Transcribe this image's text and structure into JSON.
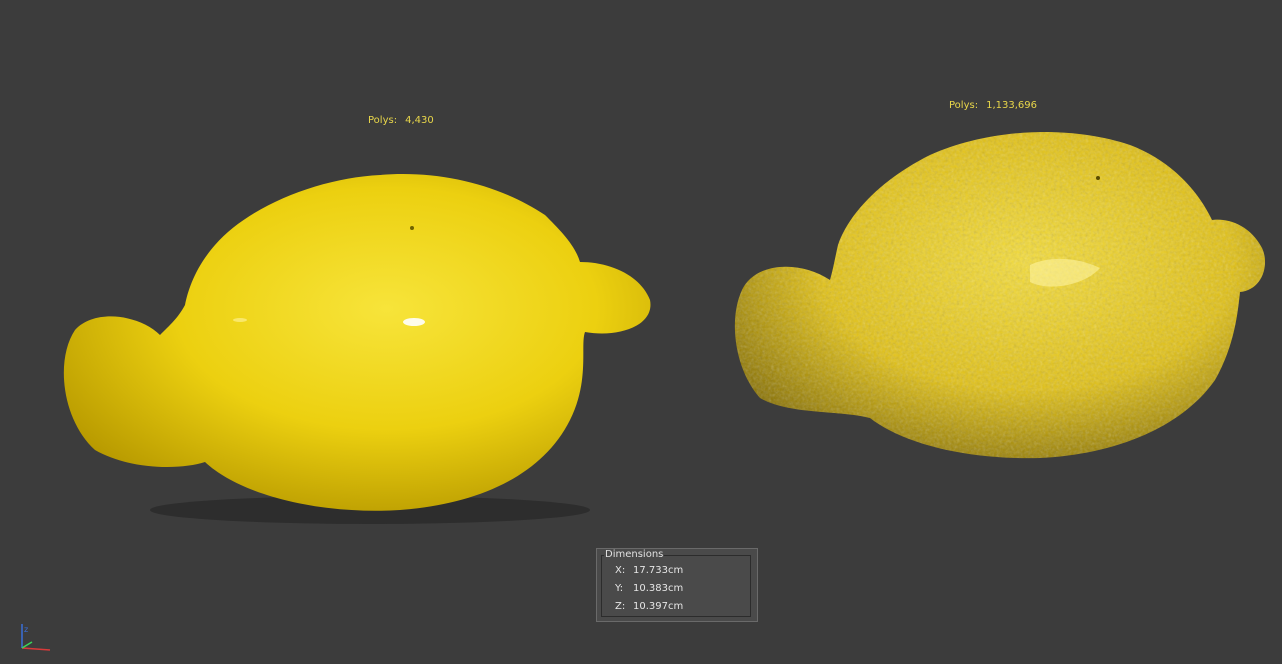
{
  "viewport": {
    "left_model": {
      "polys_label": "Polys:",
      "polys_value": "4,430"
    },
    "right_model": {
      "polys_label": "Polys:",
      "polys_value": "1,133,696"
    }
  },
  "dimensions": {
    "title": "Dimensions",
    "x": {
      "axis": "X:",
      "value": "17.733cm"
    },
    "y": {
      "axis": "Y:",
      "value": "10.383cm"
    },
    "z": {
      "axis": "Z:",
      "value": "10.397cm"
    }
  },
  "gizmo": {
    "icon": "axis-gizmo-icon",
    "z_label": "z"
  },
  "colors": {
    "background": "#3c3c3c",
    "label_yellow": "#e8d64a",
    "lemon": "#f3d81a"
  }
}
